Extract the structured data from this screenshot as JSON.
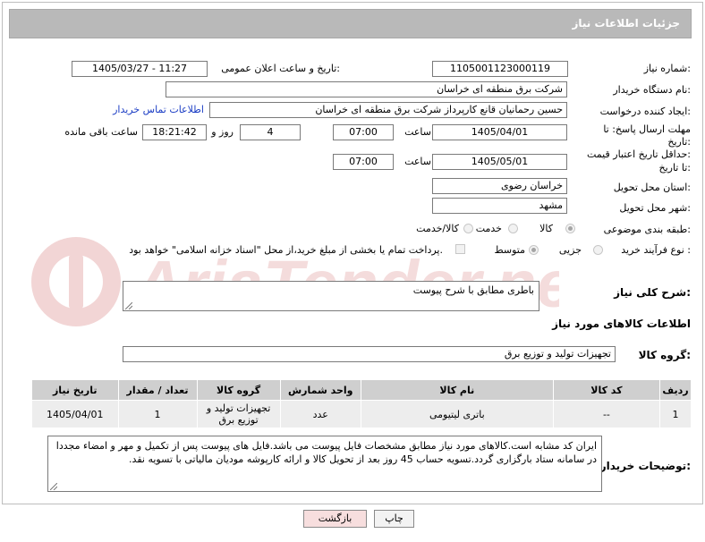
{
  "header": {
    "title": "جزئیات اطلاعات نیاز"
  },
  "form": {
    "need_number_label": "شماره نیاز:",
    "need_number": "1105001123000119",
    "announce_label": "تاریخ و ساعت اعلان عمومی:",
    "announce_value": "1405/03/27 - 11:27",
    "buyer_org_label": "نام دستگاه خریدار:",
    "buyer_org": "شرکت برق منطقه ای خراسان",
    "creator_label": "ایجاد کننده درخواست:",
    "creator": "حسین رحمانیان قانع کارپرداز شرکت برق منطقه ای خراسان",
    "contact_link": "اطلاعات تماس خریدار",
    "deadline_label_1": "مهلت ارسال پاسخ: تا",
    "deadline_label_2": "تاریخ:",
    "deadline_date": "1405/04/01",
    "time_label": "ساعت",
    "deadline_time": "07:00",
    "days_value": "4",
    "days_label": "روز و",
    "remaining_time": "18:21:42",
    "remaining_label": "ساعت باقی مانده",
    "price_label_1": "حداقل تاریخ اعتبار قیمت:",
    "price_label_2": "تا تاریخ:",
    "price_date": "1405/05/01",
    "price_time": "07:00",
    "province_label": "استان محل تحویل:",
    "province": "خراسان رضوی",
    "city_label": "شهر محل تحویل:",
    "city": "مشهد",
    "category_label": "طبقه بندی موضوعی:",
    "category_options": [
      "کالا",
      "خدمت",
      "کالا/خدمت"
    ],
    "category_selected": "کالا",
    "process_label": "نوع فرآیند خرید :",
    "process_options": [
      "جزیی",
      "متوسط"
    ],
    "process_selected": "متوسط",
    "payment_note": "پرداخت تمام یا بخشی از مبلغ خرید،از محل \"اسناد خزانه اسلامی\" خواهد بود."
  },
  "description": {
    "label": "شرح کلی نیاز:",
    "value": "باطری مطابق با شرح پیوست"
  },
  "goods": {
    "section_title": "اطلاعات کالاهای مورد نیاز",
    "group_label": "گروه کالا:",
    "group_value": "تجهیزات تولید و توزیع برق",
    "columns": [
      "ردیف",
      "کد کالا",
      "نام کالا",
      "واحد شمارش",
      "گروه کالا",
      "تعداد / مقدار",
      "تاریخ نیاز"
    ],
    "rows": [
      {
        "row": "1",
        "code": "--",
        "name": "باتری لیتیومی",
        "unit": "عدد",
        "group": "تجهیزات تولید و توزیع برق",
        "qty": "1",
        "date": "1405/04/01"
      }
    ]
  },
  "notes": {
    "label": "توضیحات خریدار:",
    "value": "ایران کد مشابه است.کالاهای مورد نیاز مطابق مشخصات فایل پیوست می باشد.فایل های پیوست پس از تکمیل و مهر و امضاء مجددا در سامانه ستاد بارگزاری گردد.تسویه حساب 45 روز بعد از تحویل کالا و ارائه کارپوشه مودیان مالیاتی با تسویه نقد."
  },
  "buttons": {
    "print": "چاپ",
    "back": "بازگشت"
  },
  "watermark": "AriaTender.net",
  "colors": {
    "header_bg": "#b9b9b9",
    "link": "#1a3cc4",
    "back_btn": "#f7dede",
    "watermark": "#e8b3b3"
  }
}
